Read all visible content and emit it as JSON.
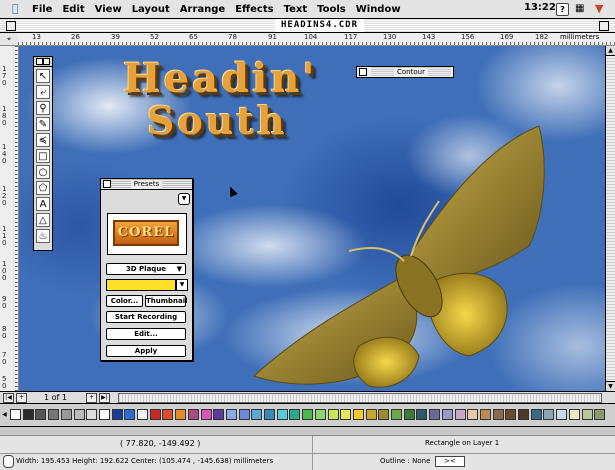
{
  "menubar": {
    "items": [
      "File",
      "Edit",
      "View",
      "Layout",
      "Arrange",
      "Effects",
      "Text",
      "Tools",
      "Window"
    ],
    "clock": "13:22"
  },
  "window": {
    "title": "HEADINS4.CDR"
  },
  "rulers": {
    "h_ticks": [
      "13",
      "26",
      "39",
      "52",
      "65",
      "78",
      "91",
      "104",
      "117",
      "130",
      "143",
      "156",
      "169",
      "182"
    ],
    "units": "millimeters",
    "v_ticks": [
      "1 7 0",
      "1 8 0",
      "1 4 0",
      "1 2 0",
      "1 1 0",
      "1 0 0",
      "9 0",
      "8 0",
      "7 0",
      "5 0"
    ]
  },
  "artwork": {
    "heading_line1": "Headin'",
    "heading_line2": "South",
    "colors": {
      "heading": "#e7a13a",
      "moth": "#a8902e",
      "sky": "#3f6fb8"
    }
  },
  "contour": {
    "title": "Contour"
  },
  "toolbox": {
    "tools": [
      "pick-tool",
      "shape-tool",
      "zoom-tool",
      "pencil-tool",
      "dimension-tool",
      "rectangle-tool",
      "ellipse-tool",
      "polygon-tool",
      "text-tool",
      "outline-tool",
      "fill-tool"
    ]
  },
  "presets": {
    "title": "Presets",
    "preview_text": "COREL",
    "style": "3D Plaque",
    "color_button": "Color...",
    "thumbnail_button": "Thumbnail",
    "start_recording": "Start Recording",
    "edit_button": "Edit...",
    "apply_button": "Apply"
  },
  "pagebar": {
    "page_label": "1  of  1"
  },
  "palette": [
    "#ffffff",
    "#2b2b2b",
    "#555555",
    "#777777",
    "#999999",
    "#bbbbbb",
    "#dddddd",
    "#ffffff",
    "#1a3a9a",
    "#2e6ad6",
    "#f2f2f2",
    "#c82828",
    "#e04a2a",
    "#e88a2a",
    "#a64a8a",
    "#d25ab4",
    "#5a3a9a",
    "#8aa8e8",
    "#6a8ad8",
    "#5aa8d8",
    "#3a8ab8",
    "#5ac8d8",
    "#2aa88a",
    "#4ab84a",
    "#8ad86a",
    "#c8e85a",
    "#e8e85a",
    "#f2c82a",
    "#c8a82a",
    "#9a8a2a",
    "#6aa84a",
    "#3a7a3a",
    "#2a5a6a",
    "#6a6a9a",
    "#9a9ac8",
    "#c8a8c8",
    "#e8c8a8",
    "#b88a5a",
    "#8a6a4a",
    "#6a4a2a",
    "#4a3a2a",
    "#3a6a8a",
    "#8aa8b8",
    "#c8d8e8",
    "#e8e8c8",
    "#b8c89a",
    "#8a9a6a"
  ],
  "status": {
    "coords": "( 77.820, -149.492 )",
    "object_info": "Rectangle on Layer 1",
    "dims": "Width: 195.453  Height: 192.622  Center: (105.474 , -145.638)  millimeters",
    "outline": "Outline : None"
  }
}
